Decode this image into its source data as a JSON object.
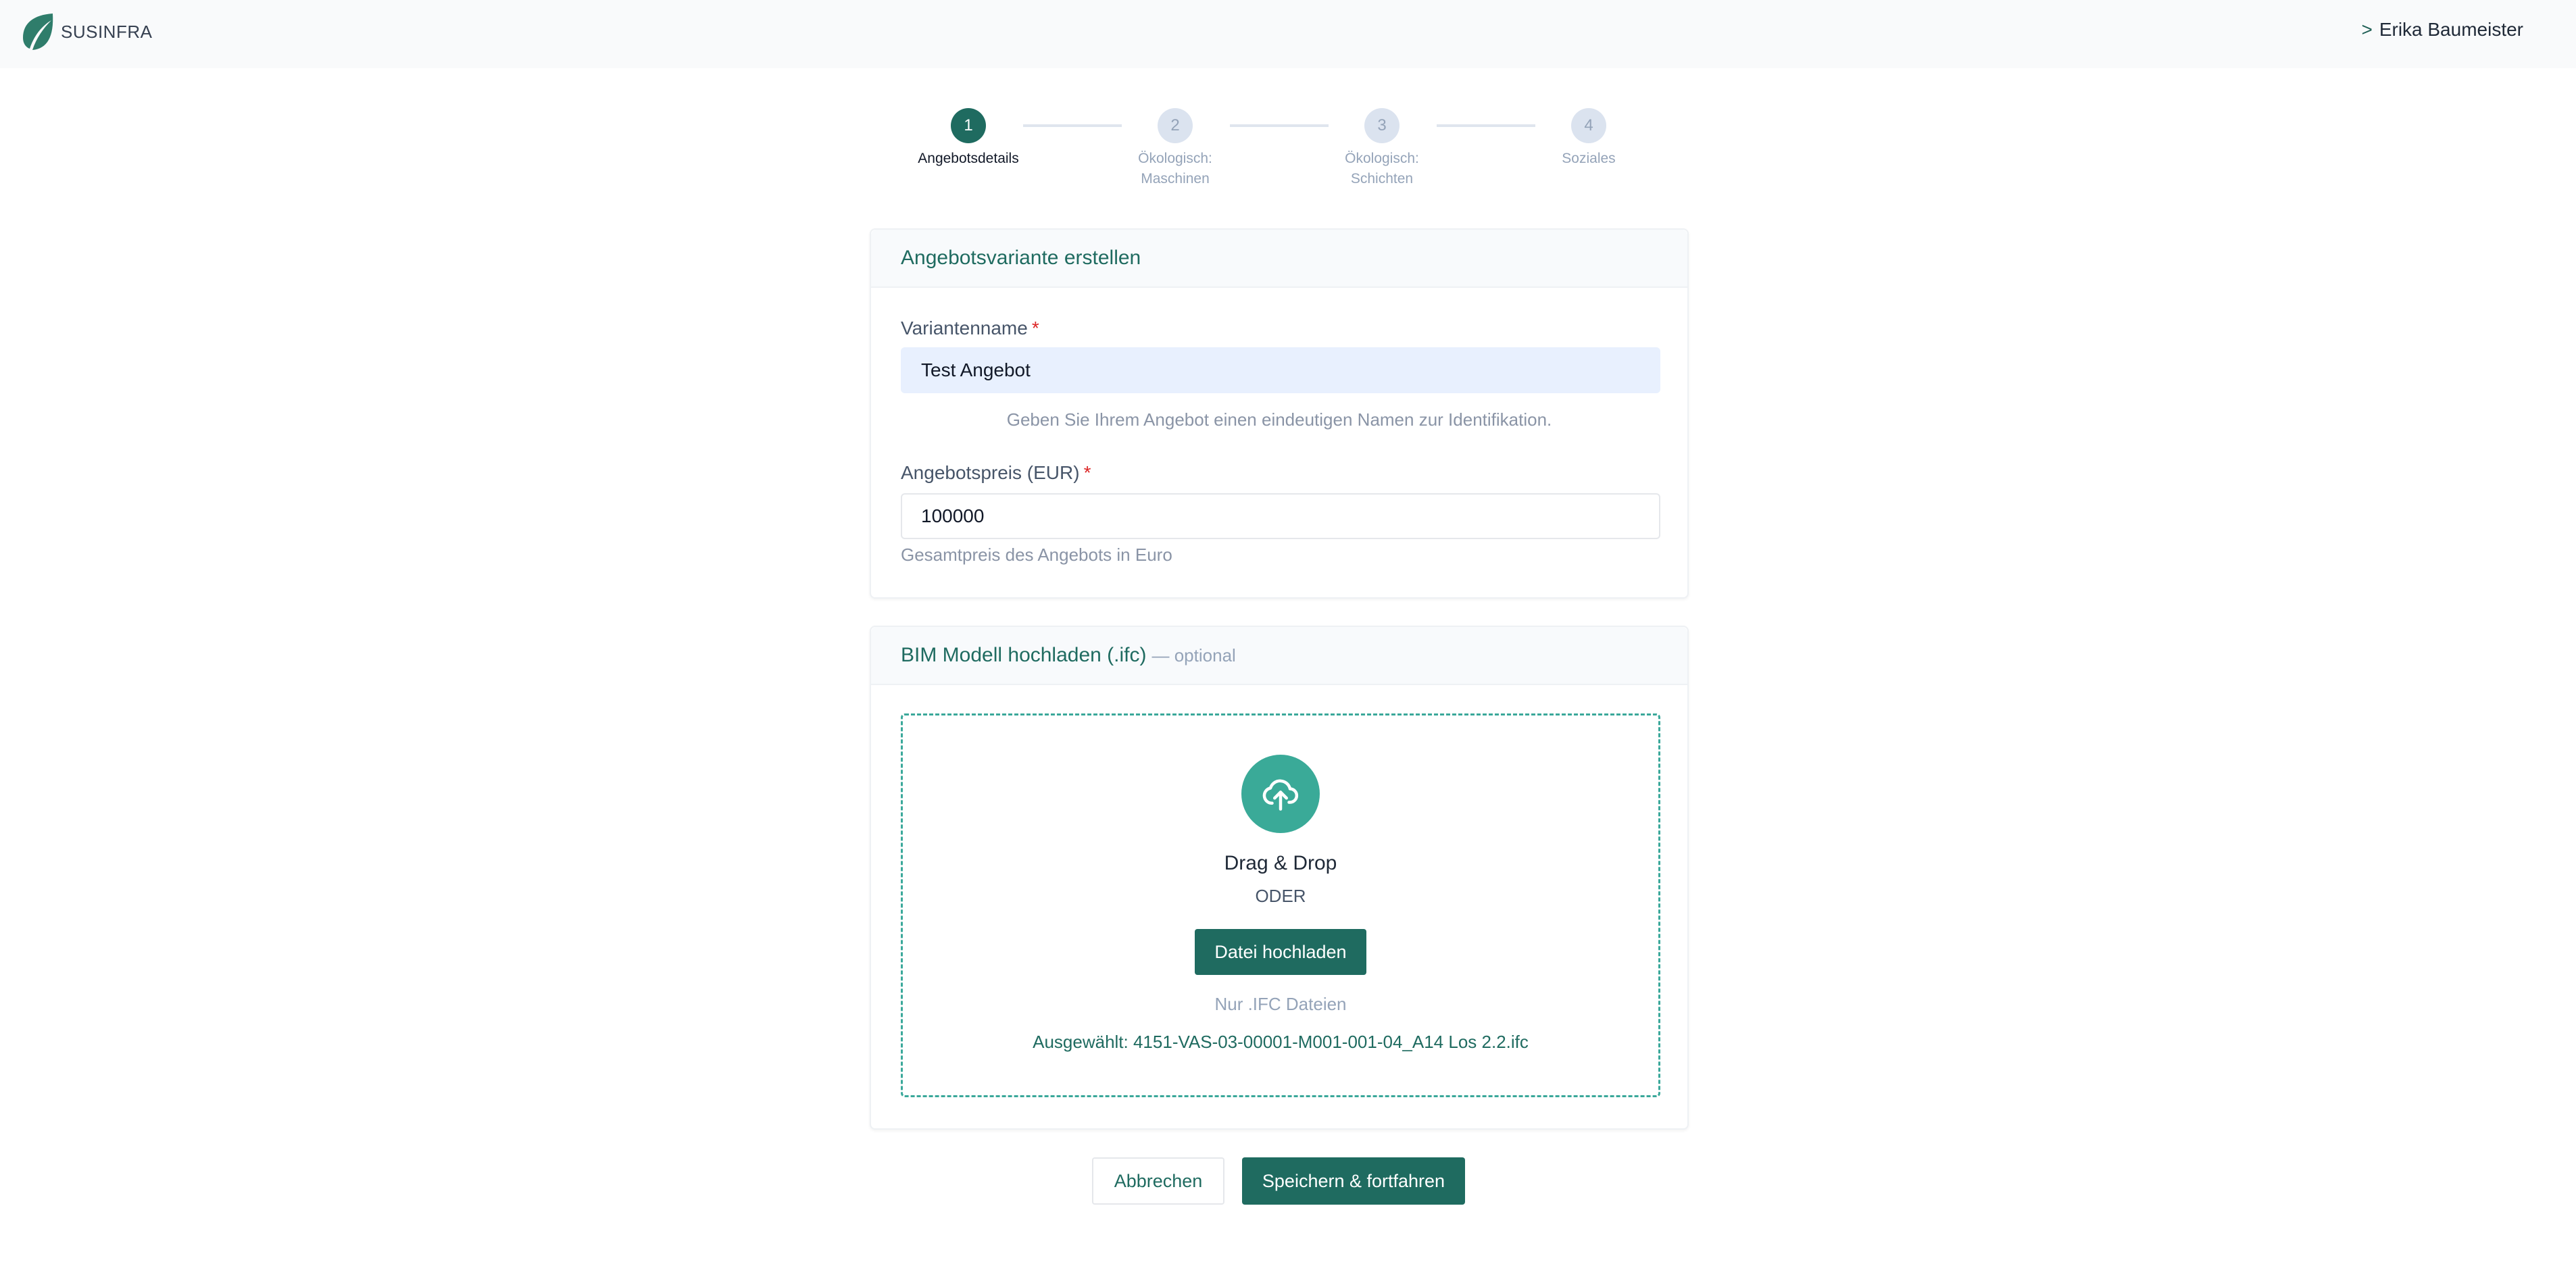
{
  "header": {
    "brand": "SUSINFRA",
    "user_prefix": ">",
    "user_name": "Erika Baumeister"
  },
  "stepper": {
    "steps": [
      {
        "number": "1",
        "label": "Angebotsdetails",
        "active": true
      },
      {
        "number": "2",
        "label_line1": "Ökologisch:",
        "label_line2": "Maschinen",
        "active": false
      },
      {
        "number": "3",
        "label_line1": "Ökologisch:",
        "label_line2": "Schichten",
        "active": false
      },
      {
        "number": "4",
        "label": "Soziales",
        "active": false
      }
    ]
  },
  "details_card": {
    "title": "Angebotsvariante erstellen",
    "variant_name": {
      "label": "Variantenname",
      "required_mark": "*",
      "value": "Test Angebot",
      "help": "Geben Sie Ihrem Angebot einen eindeutigen Namen zur Identifikation."
    },
    "price": {
      "label": "Angebotspreis (EUR)",
      "required_mark": "*",
      "value": "100000",
      "help": "Gesamtpreis des Angebots in Euro"
    }
  },
  "upload_card": {
    "title": "BIM Modell hochladen (.ifc)",
    "optional": "— optional",
    "drag_drop": "Drag & Drop",
    "or": "ODER",
    "upload_button": "Datei hochladen",
    "file_hint": "Nur .IFC Dateien",
    "selected": "Ausgewählt: 4151-VAS-03-00001-M001-001-04_A14 Los 2.2.ifc"
  },
  "actions": {
    "cancel": "Abbrechen",
    "save": "Speichern & fortfahren"
  },
  "colors": {
    "primary": "#1f6b60",
    "accent": "#3aaa98",
    "required": "#dc2626"
  }
}
